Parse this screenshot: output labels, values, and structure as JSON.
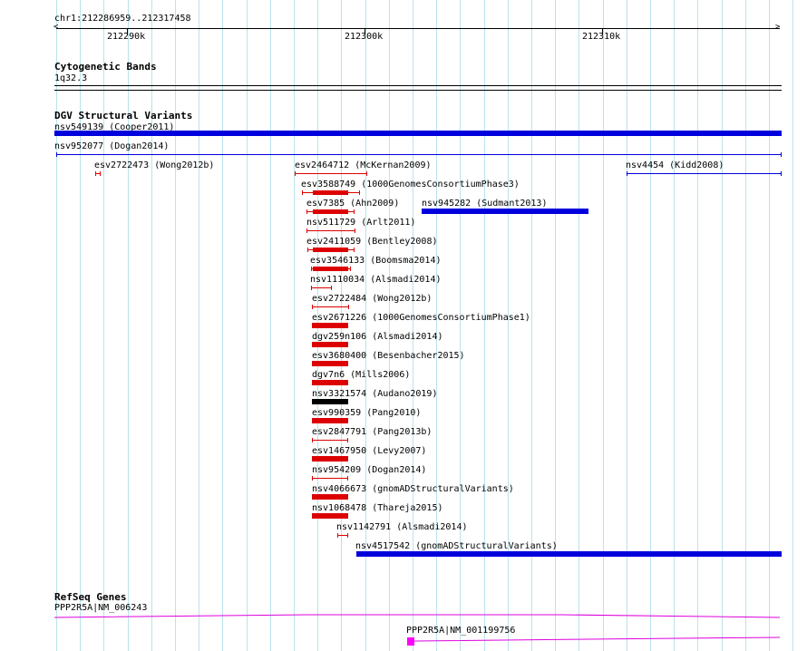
{
  "ruler": {
    "location": "chr1:212286959..212317458",
    "ticks": [
      "212290k",
      "212300k",
      "212310k"
    ]
  },
  "tracks": {
    "cytoband": {
      "title": "Cytogenetic Bands",
      "band_label": "1q32.3"
    },
    "dgv": {
      "title": "DGV Structural Variants",
      "features": [
        {
          "name": "nsv549139 (Cooper2011)",
          "color": "#0000dd",
          "style": "thick"
        },
        {
          "name": "nsv952077 (Dogan2014)",
          "color": "#0000dd",
          "style": "thin"
        },
        {
          "name": "esv2722473 (Wong2012b)",
          "color": "#dd0000",
          "style": "thin"
        },
        {
          "name": "esv2464712 (McKernan2009)",
          "color": "#dd0000",
          "style": "thin"
        },
        {
          "name": "nsv4454 (Kidd2008)",
          "color": "#0000dd",
          "style": "thin"
        },
        {
          "name": "esv3588749 (1000GenomesConsortiumPhase3)",
          "color": "#dd0000",
          "style": "mixed"
        },
        {
          "name": "esv7385 (Ahn2009)",
          "color": "#dd0000",
          "style": "mixed"
        },
        {
          "name": "nsv945282 (Sudmant2013)",
          "color": "#0000dd",
          "style": "thick"
        },
        {
          "name": "nsv511729 (Arlt2011)",
          "color": "#dd0000",
          "style": "thin"
        },
        {
          "name": "esv2411059 (Bentley2008)",
          "color": "#dd0000",
          "style": "mixed"
        },
        {
          "name": "esv3546133 (Boomsma2014)",
          "color": "#dd0000",
          "style": "mixed"
        },
        {
          "name": "nsv1110034 (Alsmadi2014)",
          "color": "#dd0000",
          "style": "thin"
        },
        {
          "name": "esv2722484 (Wong2012b)",
          "color": "#dd0000",
          "style": "thin"
        },
        {
          "name": "esv2671226 (1000GenomesConsortiumPhase1)",
          "color": "#dd0000",
          "style": "thick"
        },
        {
          "name": "dgv259n106 (Alsmadi2014)",
          "color": "#dd0000",
          "style": "thick"
        },
        {
          "name": "esv3680400 (Besenbacher2015)",
          "color": "#dd0000",
          "style": "thick"
        },
        {
          "name": "dgv7n6 (Mills2006)",
          "color": "#dd0000",
          "style": "thick"
        },
        {
          "name": "nsv3321574 (Audano2019)",
          "color": "#000000",
          "style": "thick"
        },
        {
          "name": "esv990359 (Pang2010)",
          "color": "#dd0000",
          "style": "thick"
        },
        {
          "name": "esv2847791 (Pang2013b)",
          "color": "#dd0000",
          "style": "thin"
        },
        {
          "name": "esv1467950 (Levy2007)",
          "color": "#dd0000",
          "style": "thick"
        },
        {
          "name": "nsv954209 (Dogan2014)",
          "color": "#dd0000",
          "style": "thin"
        },
        {
          "name": "nsv4066673 (gnomADStructuralVariants)",
          "color": "#dd0000",
          "style": "thick"
        },
        {
          "name": "nsv1068478 (Thareja2015)",
          "color": "#dd0000",
          "style": "thick"
        },
        {
          "name": "nsv1142791 (Alsmadi2014)",
          "color": "#dd0000",
          "style": "thin"
        },
        {
          "name": "nsv4517542 (gnomADStructuralVariants)",
          "color": "#0000dd",
          "style": "thick"
        }
      ]
    },
    "refseq": {
      "title": "RefSeq Genes",
      "transcripts": [
        {
          "name": "PPP2R5A|NM_006243",
          "color": "#dd00dd"
        },
        {
          "name": "PPP2R5A|NM_001199756",
          "color": "#dd00dd"
        }
      ]
    }
  }
}
